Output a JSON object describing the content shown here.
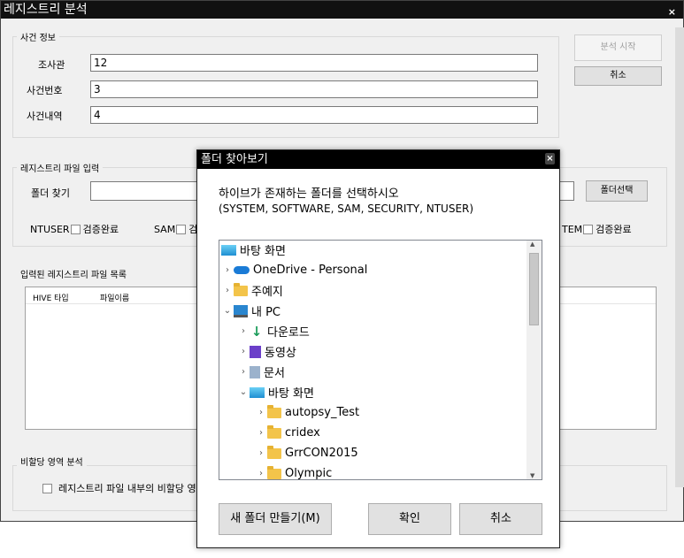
{
  "main_window": {
    "title": "레지스트리 분석",
    "close_label": "×",
    "case_info": {
      "group_label": "사건 정보",
      "fields": [
        {
          "label": "조사관",
          "value": "12"
        },
        {
          "label": "사건번호",
          "value": "3"
        },
        {
          "label": "사건내역",
          "value": "4"
        }
      ]
    },
    "start_button": "분석 시작",
    "cancel_button": "취소",
    "registry_input": {
      "group_label": "레지스트리 파일 입력",
      "folder_label": "폴더 찾기",
      "folder_select_button": "폴더선택",
      "checks": [
        "NTUSER",
        "SAM",
        "검",
        "TEM"
      ],
      "check_suffix": "검증완료"
    },
    "file_list": {
      "group_label": "입력된 레지스트리 파일 목록",
      "columns": [
        "HIVE 타입",
        "파일이름"
      ]
    },
    "unalloc": {
      "group_label": "비할당 영역 분석",
      "checkbox_label": "레지스트리 파일 내부의 비할당 영"
    }
  },
  "dialog": {
    "title": "폴더 찾아보기",
    "close_label": "×",
    "instruction_line1": "하이브가 존재하는 폴더를 선택하시오",
    "instruction_line2": "(SYSTEM, SOFTWARE, SAM, SECURITY, NTUSER)",
    "tree": [
      {
        "label": "바탕 화면",
        "icon": "desktop-icon"
      },
      {
        "label": "OneDrive - Personal",
        "icon": "onedrive-icon"
      },
      {
        "label": "주예지",
        "icon": "folder-icon"
      },
      {
        "label": "내 PC",
        "icon": "pc-icon"
      },
      {
        "label": "다운로드",
        "icon": "download-icon"
      },
      {
        "label": "동영상",
        "icon": "video-icon"
      },
      {
        "label": "문서",
        "icon": "document-icon"
      },
      {
        "label": "바탕 화면",
        "icon": "desktop-icon"
      },
      {
        "label": "autopsy_Test",
        "icon": "folder-icon"
      },
      {
        "label": "cridex",
        "icon": "folder-icon"
      },
      {
        "label": "GrrCON2015",
        "icon": "folder-icon"
      },
      {
        "label": "Olympic",
        "icon": "folder-icon"
      }
    ],
    "new_folder_button": "새 폴더 만들기(M)",
    "ok_button": "확인",
    "cancel_button": "취소"
  }
}
